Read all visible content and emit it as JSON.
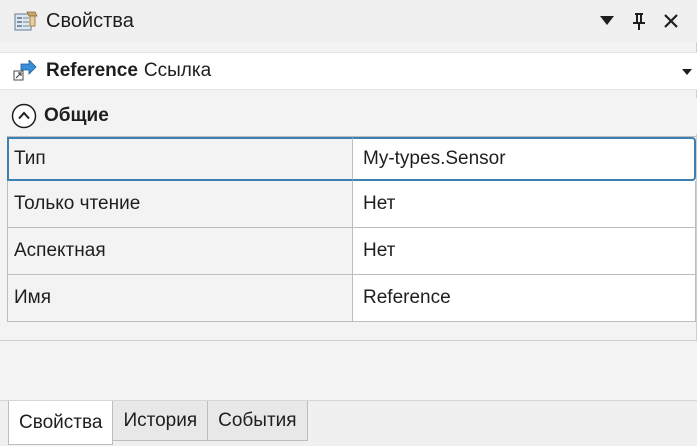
{
  "window": {
    "title": "Свойства",
    "title_icon": "properties-window-icon",
    "controls": {
      "dropdown_icon": "triangle-down-icon",
      "pin_icon": "pin-icon",
      "close_icon": "close-icon",
      "pin_glyph": "ᵽ",
      "close_glyph": "✕"
    }
  },
  "selected_object": {
    "icon": "reference-arrow-icon",
    "name": "Reference",
    "type": "Ссылка"
  },
  "category": {
    "label": "Общие",
    "collapse_icon": "chevron-up-circle-icon"
  },
  "properties": [
    {
      "name": "Тип",
      "value": "My-types.Sensor",
      "selected": true
    },
    {
      "name": "Только чтение",
      "value": "Нет"
    },
    {
      "name": "Аспектная",
      "value": "Нет"
    },
    {
      "name": "Имя",
      "value": "Reference"
    }
  ],
  "tabs": [
    {
      "label": "Свойства",
      "active": true
    },
    {
      "label": "История"
    },
    {
      "label": "События"
    }
  ],
  "colors": {
    "selection_border": "#3c7fb1",
    "panel_bg": "#f3f3f3",
    "value_bg": "#ffffff",
    "grid_line": "#bdbdbd"
  }
}
